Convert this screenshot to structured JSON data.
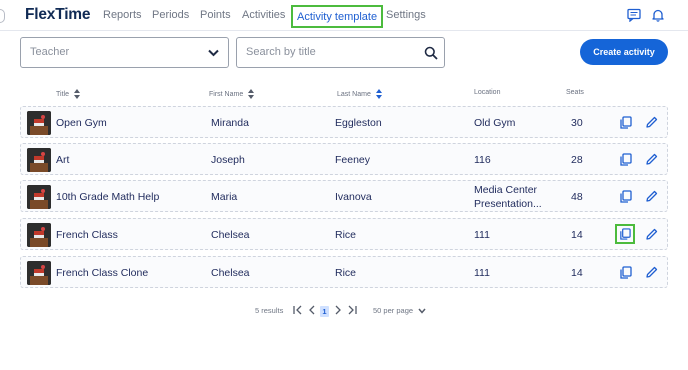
{
  "app": {
    "logo": "FlexTime"
  },
  "nav": {
    "reports": "Reports",
    "periods": "Periods",
    "points": "Points",
    "activities": "Activities",
    "activity_template": "Activity template",
    "settings": "Settings"
  },
  "icons": {
    "messages": "message-icon",
    "notifications": "bell-icon",
    "copy": "copy-icon",
    "edit": "pencil-icon",
    "search": "search-icon"
  },
  "filters": {
    "teacher_value": "Teacher",
    "search_placeholder": "Search by title",
    "create_label": "Create activity"
  },
  "table": {
    "headers": {
      "title": "Title",
      "first_name": "First Name",
      "last_name": "Last Name",
      "location": "Location",
      "seats": "Seats"
    },
    "rows": [
      {
        "title": "Open Gym",
        "first_name": "Miranda",
        "last_name": "Eggleston",
        "location": "Old Gym",
        "location2": "",
        "seats": "30"
      },
      {
        "title": "Art",
        "first_name": "Joseph",
        "last_name": "Feeney",
        "location": "116",
        "location2": "",
        "seats": "28"
      },
      {
        "title": "10th Grade Math Help",
        "first_name": "Maria",
        "last_name": "Ivanova",
        "location": "Media Center",
        "location2": "Presentation...",
        "seats": "48"
      },
      {
        "title": "French Class",
        "first_name": "Chelsea",
        "last_name": "Rice",
        "location": "111",
        "location2": "",
        "seats": "14"
      },
      {
        "title": "French Class Clone",
        "first_name": "Chelsea",
        "last_name": "Rice",
        "location": "111",
        "location2": "",
        "seats": "14"
      }
    ]
  },
  "pagination": {
    "results": "5 results",
    "current_page": "1",
    "per_page": "50 per page"
  },
  "colors": {
    "accent": "#1565d8",
    "highlight": "#4cbb3d",
    "brand": "#102a54"
  }
}
